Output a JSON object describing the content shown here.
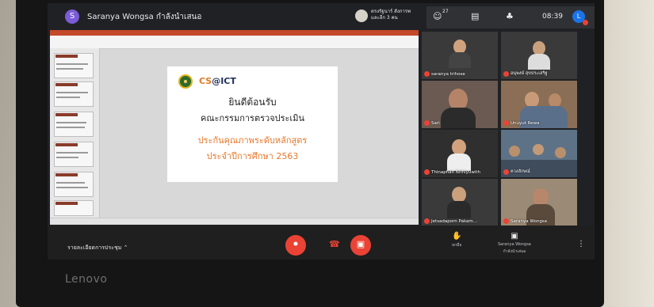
{
  "presenter": {
    "avatar_letter": "S",
    "text": "Saranya Wongsa กำลังนำเสนอ"
  },
  "caption_chip": {
    "text": "ตรงรัฐนาร์ สังการพ และอีก 3 คน"
  },
  "top_right": {
    "participant_count": "27",
    "clock": "08:39",
    "self_avatar_letter": "L"
  },
  "slide": {
    "logo_cs": "CS",
    "logo_rest": "@ICT",
    "line1": "ยินดีต้อนรับ",
    "line2": "คณะกรรมการตรวจประเมิน",
    "line3": "ประกันคุณภาพระดับหลักสูตร",
    "line4": "ประจำปีการศึกษา 2563"
  },
  "participants": [
    {
      "name": "saranya trihose"
    },
    {
      "name": "อนุพงษ์ สุขประเสริฐ"
    },
    {
      "name": "Sari"
    },
    {
      "name": "Unuyut Rewa"
    },
    {
      "name": "Thinaphan Nithiyuwith"
    },
    {
      "name": "ควงลักษณ์"
    },
    {
      "name": "Jetsadaporn Pakam..."
    },
    {
      "name": "Saranya Wongsa"
    }
  ],
  "bottom": {
    "meeting_details": "รายละเอียดการประชุม",
    "raise_hand_label": "ยกมือ",
    "presenter_label": "Saranya Wongsa",
    "presenter_sub": "กำลังนำเสนอ"
  },
  "monitor_brand": "Lenovo",
  "colors": {
    "accent_red": "#ea4335",
    "meet_dark": "#202124",
    "slide_orange": "#e9772a"
  }
}
